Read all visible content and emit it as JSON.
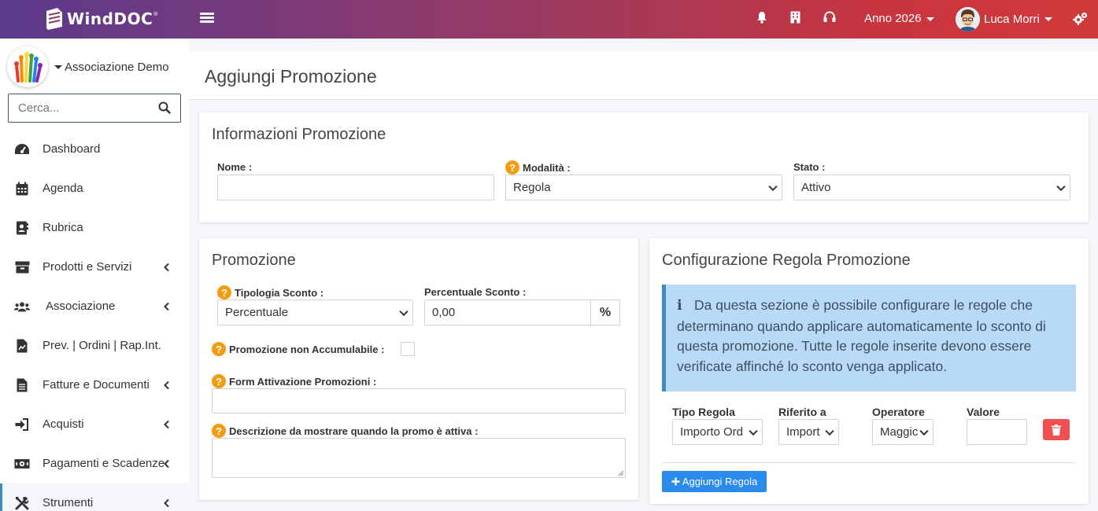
{
  "app": {
    "logo_text": "WindDOC",
    "logo_mark": "®"
  },
  "topbar": {
    "year_label": "Anno 2026",
    "user_name": "Luca Morri",
    "icons": [
      "bell-icon",
      "building-icon",
      "headset-icon",
      "settings-icon"
    ]
  },
  "sidebar": {
    "org_name": "Associazione Demo",
    "search_placeholder": "Cerca...",
    "items": [
      {
        "label": "Dashboard",
        "icon": "dashboard-icon",
        "has_children": false
      },
      {
        "label": "Agenda",
        "icon": "calendar-icon",
        "has_children": false
      },
      {
        "label": "Rubrica",
        "icon": "address-book-icon",
        "has_children": false
      },
      {
        "label": "Prodotti e Servizi",
        "icon": "box-icon",
        "has_children": true
      },
      {
        "label": "Associazione",
        "icon": "users-icon",
        "has_children": true
      },
      {
        "label": "Prev. | Ordini | Rap.Int.",
        "icon": "document-chart-icon",
        "has_children": false
      },
      {
        "label": "Fatture e Documenti",
        "icon": "file-icon",
        "has_children": true
      },
      {
        "label": "Acquisti",
        "icon": "sign-in-icon",
        "has_children": true
      },
      {
        "label": "Pagamenti e Scadenze",
        "icon": "money-icon",
        "has_children": true
      },
      {
        "label": "Strumenti",
        "icon": "tools-icon",
        "has_children": true,
        "active": true
      }
    ]
  },
  "page": {
    "title": "Aggiungi Promozione"
  },
  "info_promo": {
    "title": "Informazioni Promozione",
    "nome_label": "Nome :",
    "nome_value": "",
    "modalita_label": "Modalità :",
    "modalita_value": "Regola",
    "stato_label": "Stato :",
    "stato_value": "Attivo"
  },
  "promozione": {
    "title": "Promozione",
    "tipologia_label": "Tipologia Sconto :",
    "tipologia_value": "Percentuale",
    "percentuale_label": "Percentuale Sconto :",
    "percentuale_value": "0,00",
    "percent_symbol": "%",
    "non_accumulabile_label": "Promozione non Accumulabile :",
    "non_accumulabile_checked": false,
    "form_label": "Form Attivazione Promozioni :",
    "form_value": "",
    "descrizione_label": "Descrizione da mostrare quando la promo è attiva :",
    "descrizione_value": ""
  },
  "regola": {
    "title": "Configurazione Regola Promozione",
    "info_text": "Da questa sezione è possibile configurare le regole che determinano quando applicare automaticamente lo sconto di questa promozione. Tutte le regole inserite devono essere verificate affinché lo sconto venga applicato.",
    "col_tipo": "Tipo Regola",
    "col_riferito": "Riferito a",
    "col_operatore": "Operatore",
    "col_valore": "Valore",
    "row": {
      "tipo": "Importo Ord",
      "riferito": "Import",
      "operatore": "Maggic",
      "valore": ""
    },
    "add_button": "Aggiungi Regola"
  },
  "colors": {
    "accent": "#3c8dbc",
    "question": "#f39c12",
    "danger": "#f05050",
    "primary_button": "#2a8bec",
    "info_bg": "#b8daf7"
  }
}
